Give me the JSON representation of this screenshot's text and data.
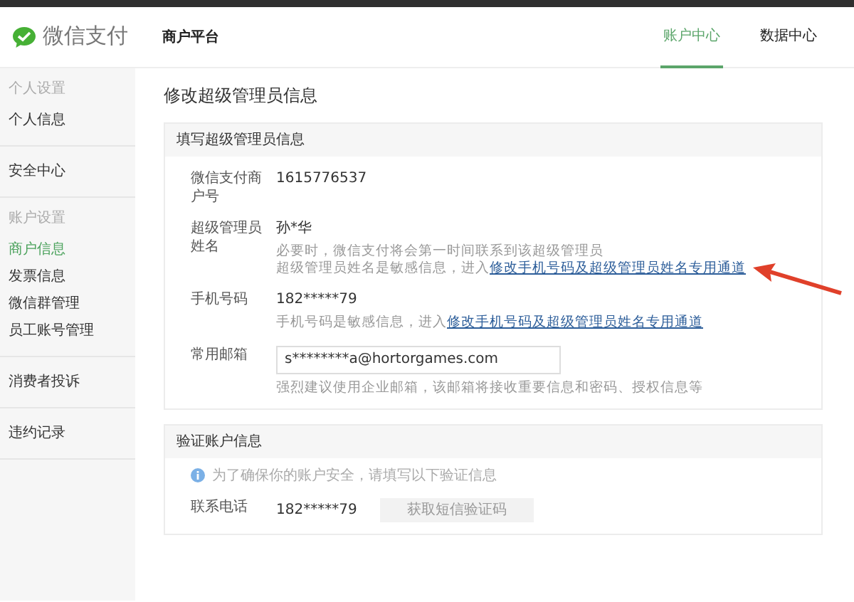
{
  "header": {
    "logo": "微信支付",
    "platform": "商户平台",
    "nav": [
      {
        "label": "账户中心",
        "selected": true
      },
      {
        "label": "数据中心",
        "selected": false
      }
    ]
  },
  "sidebar": {
    "groups": [
      {
        "heading": "个人设置",
        "items": [
          {
            "label": "个人信息",
            "selected": false
          }
        ]
      },
      {
        "items": [
          {
            "label": "安全中心",
            "selected": false
          }
        ]
      },
      {
        "heading": "账户设置",
        "items": [
          {
            "label": "商户信息",
            "selected": true
          },
          {
            "label": "发票信息",
            "selected": false
          },
          {
            "label": "微信群管理",
            "selected": false
          },
          {
            "label": "员工账号管理",
            "selected": false
          }
        ]
      },
      {
        "items": [
          {
            "label": "消费者投诉",
            "selected": false
          }
        ]
      },
      {
        "items": [
          {
            "label": "违约记录",
            "selected": false
          }
        ]
      }
    ]
  },
  "page_title": "修改超级管理员信息",
  "panels": [
    {
      "title": "填写超级管理员信息",
      "fields": [
        {
          "kind": "text",
          "label": "微信支付商户号",
          "value": "1615776537"
        },
        {
          "kind": "text",
          "label": "超级管理员姓名",
          "value": "孙*华",
          "hints": [
            {
              "text": "必要时，微信支付将会第一时间联系到该超级管理员"
            },
            {
              "text": "超级管理员姓名是敏感信息，进入",
              "link": "修改手机号码及超级管理员姓名专用通道"
            }
          ]
        },
        {
          "kind": "text",
          "label": "手机号码",
          "value": "182*****79",
          "hints": [
            {
              "text": "手机号码是敏感信息，进入",
              "link": "修改手机号码及超级管理员姓名专用通道"
            }
          ]
        },
        {
          "kind": "input",
          "label": "常用邮箱",
          "value": "s********a@hortorgames.com",
          "hints": [
            {
              "text": "强烈建议使用企业邮箱，该邮箱将接收重要信息和密码、授权信息等"
            }
          ]
        }
      ]
    },
    {
      "title": "验证账户信息",
      "notice": "为了确保你的账户安全，请填写以下验证信息",
      "fields": [
        {
          "kind": "sms",
          "label": "联系电话",
          "value": "182*****79",
          "button": "获取短信验证码"
        }
      ]
    }
  ]
}
